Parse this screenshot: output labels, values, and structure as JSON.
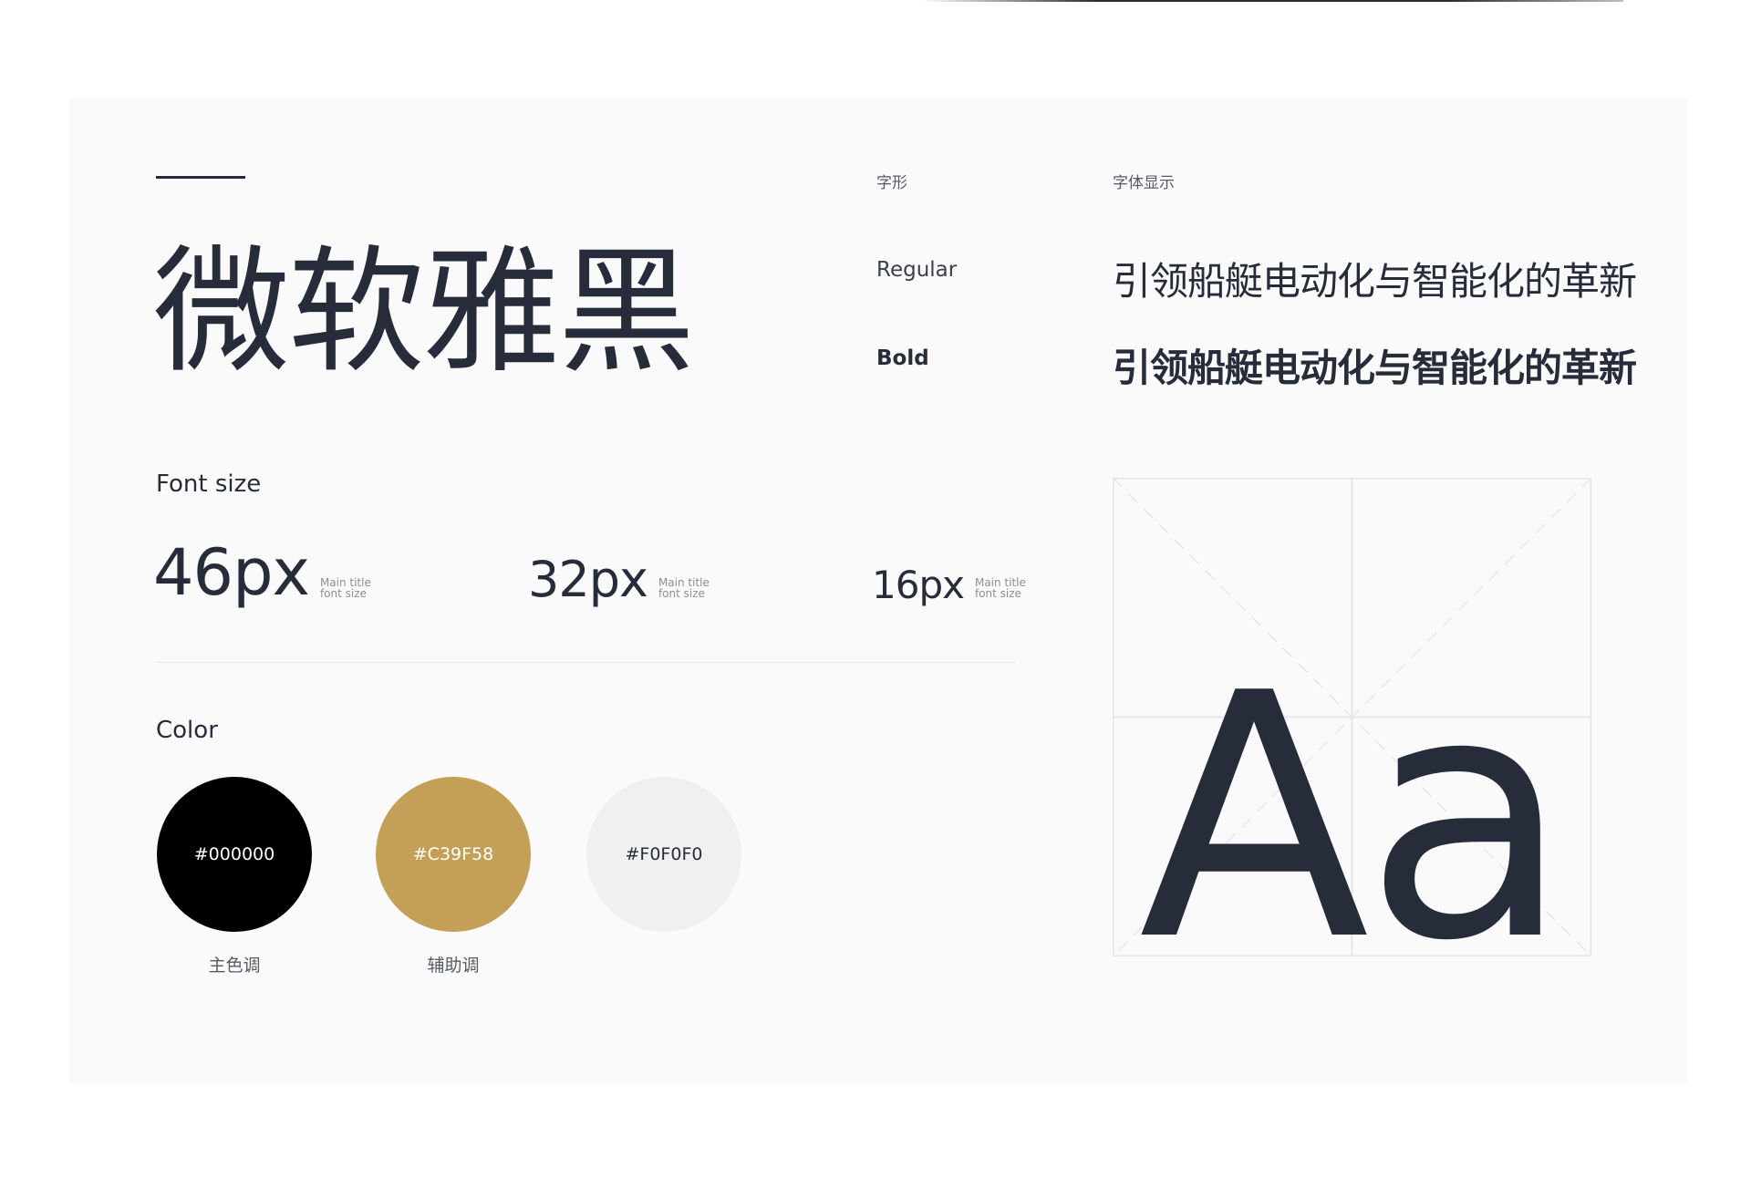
{
  "font_name": "微软雅黑",
  "columns": {
    "glyph": "字形",
    "display": "字体显示"
  },
  "weights": [
    {
      "label": "Regular",
      "sample": "引领船艇电动化与智能化的革新"
    },
    {
      "label": "Bold",
      "sample": "引领船艇电动化与智能化的革新"
    }
  ],
  "font_size": {
    "label": "Font size",
    "items": [
      {
        "value": "46px",
        "note_line1": "Main title",
        "note_line2": "font size"
      },
      {
        "value": "32px",
        "note_line1": "Main title",
        "note_line2": "font size"
      },
      {
        "value": "16px",
        "note_line1": "Main title",
        "note_line2": "font size"
      }
    ]
  },
  "color": {
    "label": "Color",
    "swatches": [
      {
        "hex": "#000000",
        "text_color": "#ffffff",
        "label": "主色调"
      },
      {
        "hex": "#C39F58",
        "text_color": "#ffffff",
        "label": "辅助调"
      },
      {
        "hex": "#F0F0F0",
        "text_color": "#262c3a",
        "label": ""
      }
    ]
  },
  "glyph_preview": "Aa"
}
